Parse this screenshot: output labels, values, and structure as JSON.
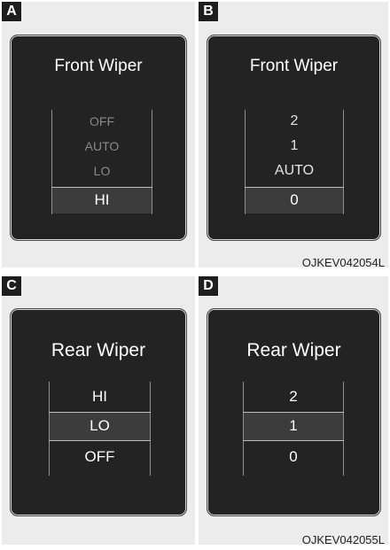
{
  "panels": {
    "A": {
      "tag": "A",
      "title": "Front Wiper",
      "items": [
        "OFF",
        "AUTO",
        "LO",
        "HI"
      ]
    },
    "B": {
      "tag": "B",
      "title": "Front Wiper",
      "items": [
        "2",
        "1",
        "AUTO",
        "0"
      ]
    },
    "C": {
      "tag": "C",
      "title": "Rear Wiper",
      "items": [
        "HI",
        "LO",
        "OFF"
      ]
    },
    "D": {
      "tag": "D",
      "title": "Rear Wiper",
      "items": [
        "2",
        "1",
        "0"
      ]
    }
  },
  "codes": {
    "top": "OJKEV042054L",
    "bottom": "OJKEV042055L"
  },
  "colors": {
    "screen": "#232323",
    "panel": "#ececec",
    "selected_row": "#3c3c3c"
  }
}
